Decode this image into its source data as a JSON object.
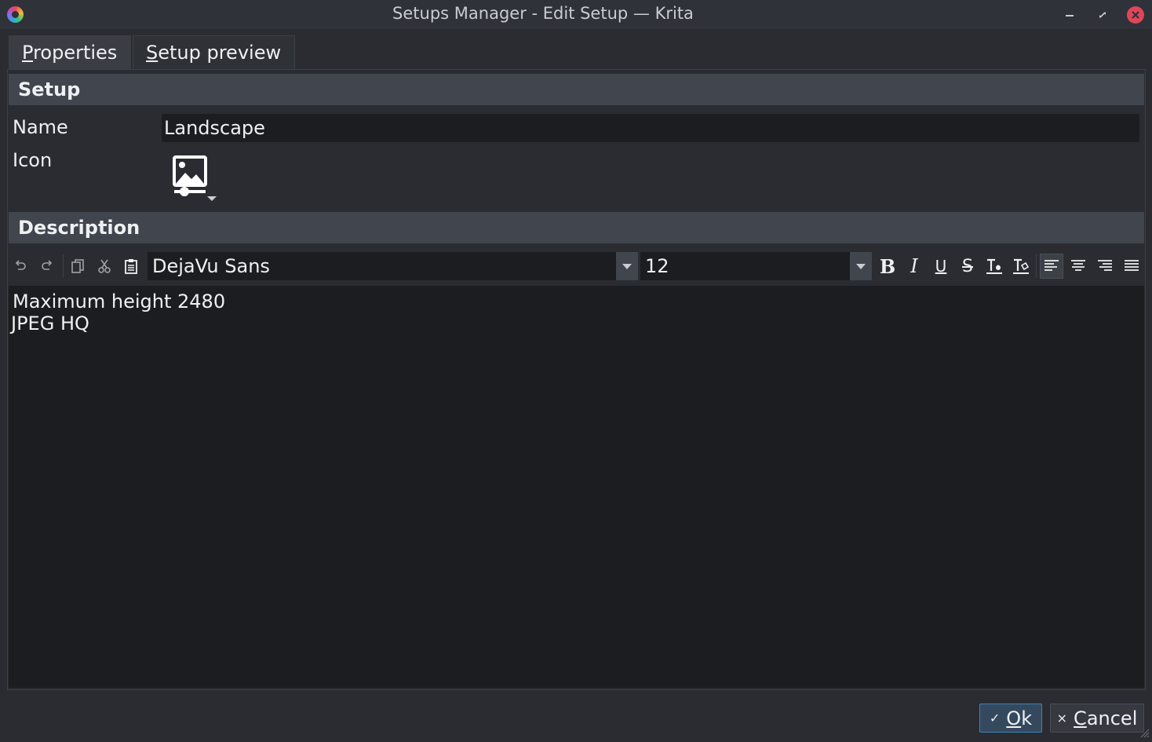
{
  "window": {
    "title": "Setups Manager - Edit Setup — Krita",
    "minimize_glyph": "−",
    "restore_glyph": "↗",
    "close_glyph": "×"
  },
  "tabs": [
    {
      "label": "Properties",
      "mnemonic": "P",
      "rest": "roperties",
      "active": true
    },
    {
      "label": "Setup preview",
      "mnemonic": "S",
      "rest": "etup preview",
      "active": false
    }
  ],
  "setup_section": {
    "header": "Setup",
    "name_label": "Name",
    "name_value": "Landscape",
    "icon_label": "Icon",
    "icon": "image-icon"
  },
  "description_section": {
    "header": "Description",
    "toolbar": {
      "undo_icon": "undo-icon",
      "redo_icon": "redo-icon",
      "copy_icon": "copy-icon",
      "cut_icon": "cut-icon",
      "paste_icon": "paste-icon",
      "font_family": "DejaVu Sans",
      "font_size": "12",
      "bold_glyph": "B",
      "italic_glyph": "I",
      "underline_glyph": "U",
      "strike_glyph": "S"
    },
    "text_lines": [
      "Maximum height 2480",
      "JPEG HQ"
    ]
  },
  "buttons": {
    "ok_label": "Ok",
    "ok_mnemonic": "O",
    "ok_rest": "k",
    "ok_glyph": "✓",
    "cancel_label": "Cancel",
    "cancel_mnemonic": "C",
    "cancel_rest": "ancel",
    "cancel_glyph": "×"
  },
  "colors": {
    "background": "#2a2c31",
    "section_header": "#41454d",
    "field_background": "#1b1d20",
    "accent": "#3f82b6",
    "close": "#e0455a"
  }
}
